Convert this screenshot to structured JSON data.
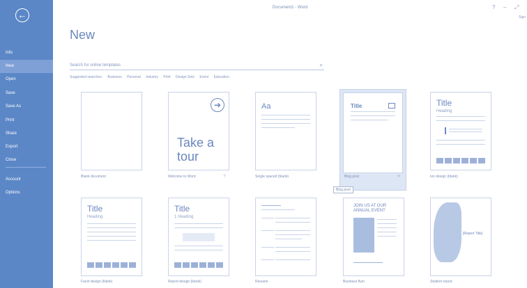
{
  "window": {
    "title": "Document1 - Word",
    "controls": [
      "?",
      "–",
      "⤢"
    ],
    "signin": "Sign"
  },
  "sidebar": {
    "back": "←",
    "items": [
      {
        "label": "Info"
      },
      {
        "label": "New"
      },
      {
        "label": "Open"
      },
      {
        "label": "Save"
      },
      {
        "label": "Save As"
      },
      {
        "label": "Print"
      },
      {
        "label": "Share"
      },
      {
        "label": "Export"
      },
      {
        "label": "Close"
      },
      {
        "label": "Account"
      },
      {
        "label": "Options"
      }
    ]
  },
  "main": {
    "heading": "New",
    "search_placeholder": "Search for online templates",
    "suggested_label": "Suggested searches:",
    "suggested": [
      "Business",
      "Personal",
      "Industry",
      "Print",
      "Design Sets",
      "Event",
      "Education"
    ]
  },
  "templates": [
    {
      "label": "Blank document"
    },
    {
      "label": "Welcome to Word",
      "tour_line1": "Take a",
      "tour_line2": "tour",
      "pin": "⊤"
    },
    {
      "label": "Single spaced (blank)",
      "aa": "Aa"
    },
    {
      "label": "Blog post",
      "tile_title": "Title"
    },
    {
      "label": "Ion design (blank)",
      "tile_title": "Title",
      "tile_sub": "Heading"
    },
    {
      "label": "Facet design (blank)",
      "tile_title": "Title",
      "tile_sub": "Heading"
    },
    {
      "label": "Report design (blank)",
      "tile_title": "Title",
      "tile_sub": "1  Heading"
    },
    {
      "label": "Resume"
    },
    {
      "label": "Business flyer",
      "flyer_line1": "JOIN US AT OUR",
      "flyer_line2": "ANNUAL EVENT"
    },
    {
      "label": "Student report",
      "report_title": "[Report Title]"
    }
  ],
  "tooltip": "Blog post"
}
